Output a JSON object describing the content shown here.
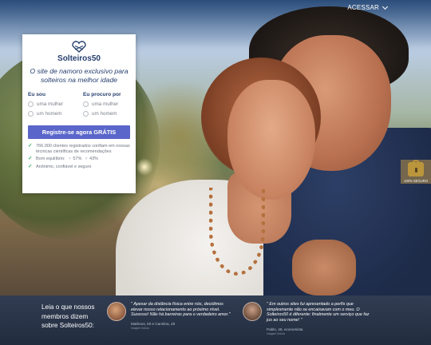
{
  "nav": {
    "login_label": "ACESSAR"
  },
  "brand": {
    "name": "Solteiros50",
    "tagline": "O site de namoro exclusivo para solteiros na melhor idade",
    "accent_color": "#27406f"
  },
  "form": {
    "i_am": {
      "label": "Eu sou",
      "options": [
        "uma mulher",
        "um homem"
      ]
    },
    "looking_for": {
      "label": "Eu procuro por",
      "options": [
        "uma mulher",
        "um homem"
      ]
    },
    "cta_label": "Registre-se agora GRÁTIS",
    "cta_color": "#5a66c9"
  },
  "benefits": {
    "item1": "766.000 clientes registrados confiam em nossas técnicas científicas de recomendações",
    "item2_label": "Bom equilíbrio:",
    "female_pct": "57%",
    "male_pct": "43%",
    "item3": "Anônimo, confiável e seguro"
  },
  "security_badge": {
    "label": "100% SEGURO",
    "icon": "lock-icon"
  },
  "testimonials": {
    "lead": "Leia o que nossos membros dizem sobre Solteiros50:",
    "items": [
      {
        "quote": "\" Apesar da distância física entre nós, decidimos elevar nosso relacionamento ao próximo nível. Sucesso! Não há barreiras para o verdadeiro amor.\"",
        "author": "Matheus, 50 e Carolina, 48",
        "note": "Imagem fictícia"
      },
      {
        "quote": "\" Em outros sites fui apresentado a perfis que simplesmente não se encaixavam com o meu. O Solteiros50 é diferente: finalmente um serviço que faz jus ao seu nome! \"",
        "author": "Pablo, 49, economista",
        "note": "Imagem fictícia"
      }
    ]
  }
}
